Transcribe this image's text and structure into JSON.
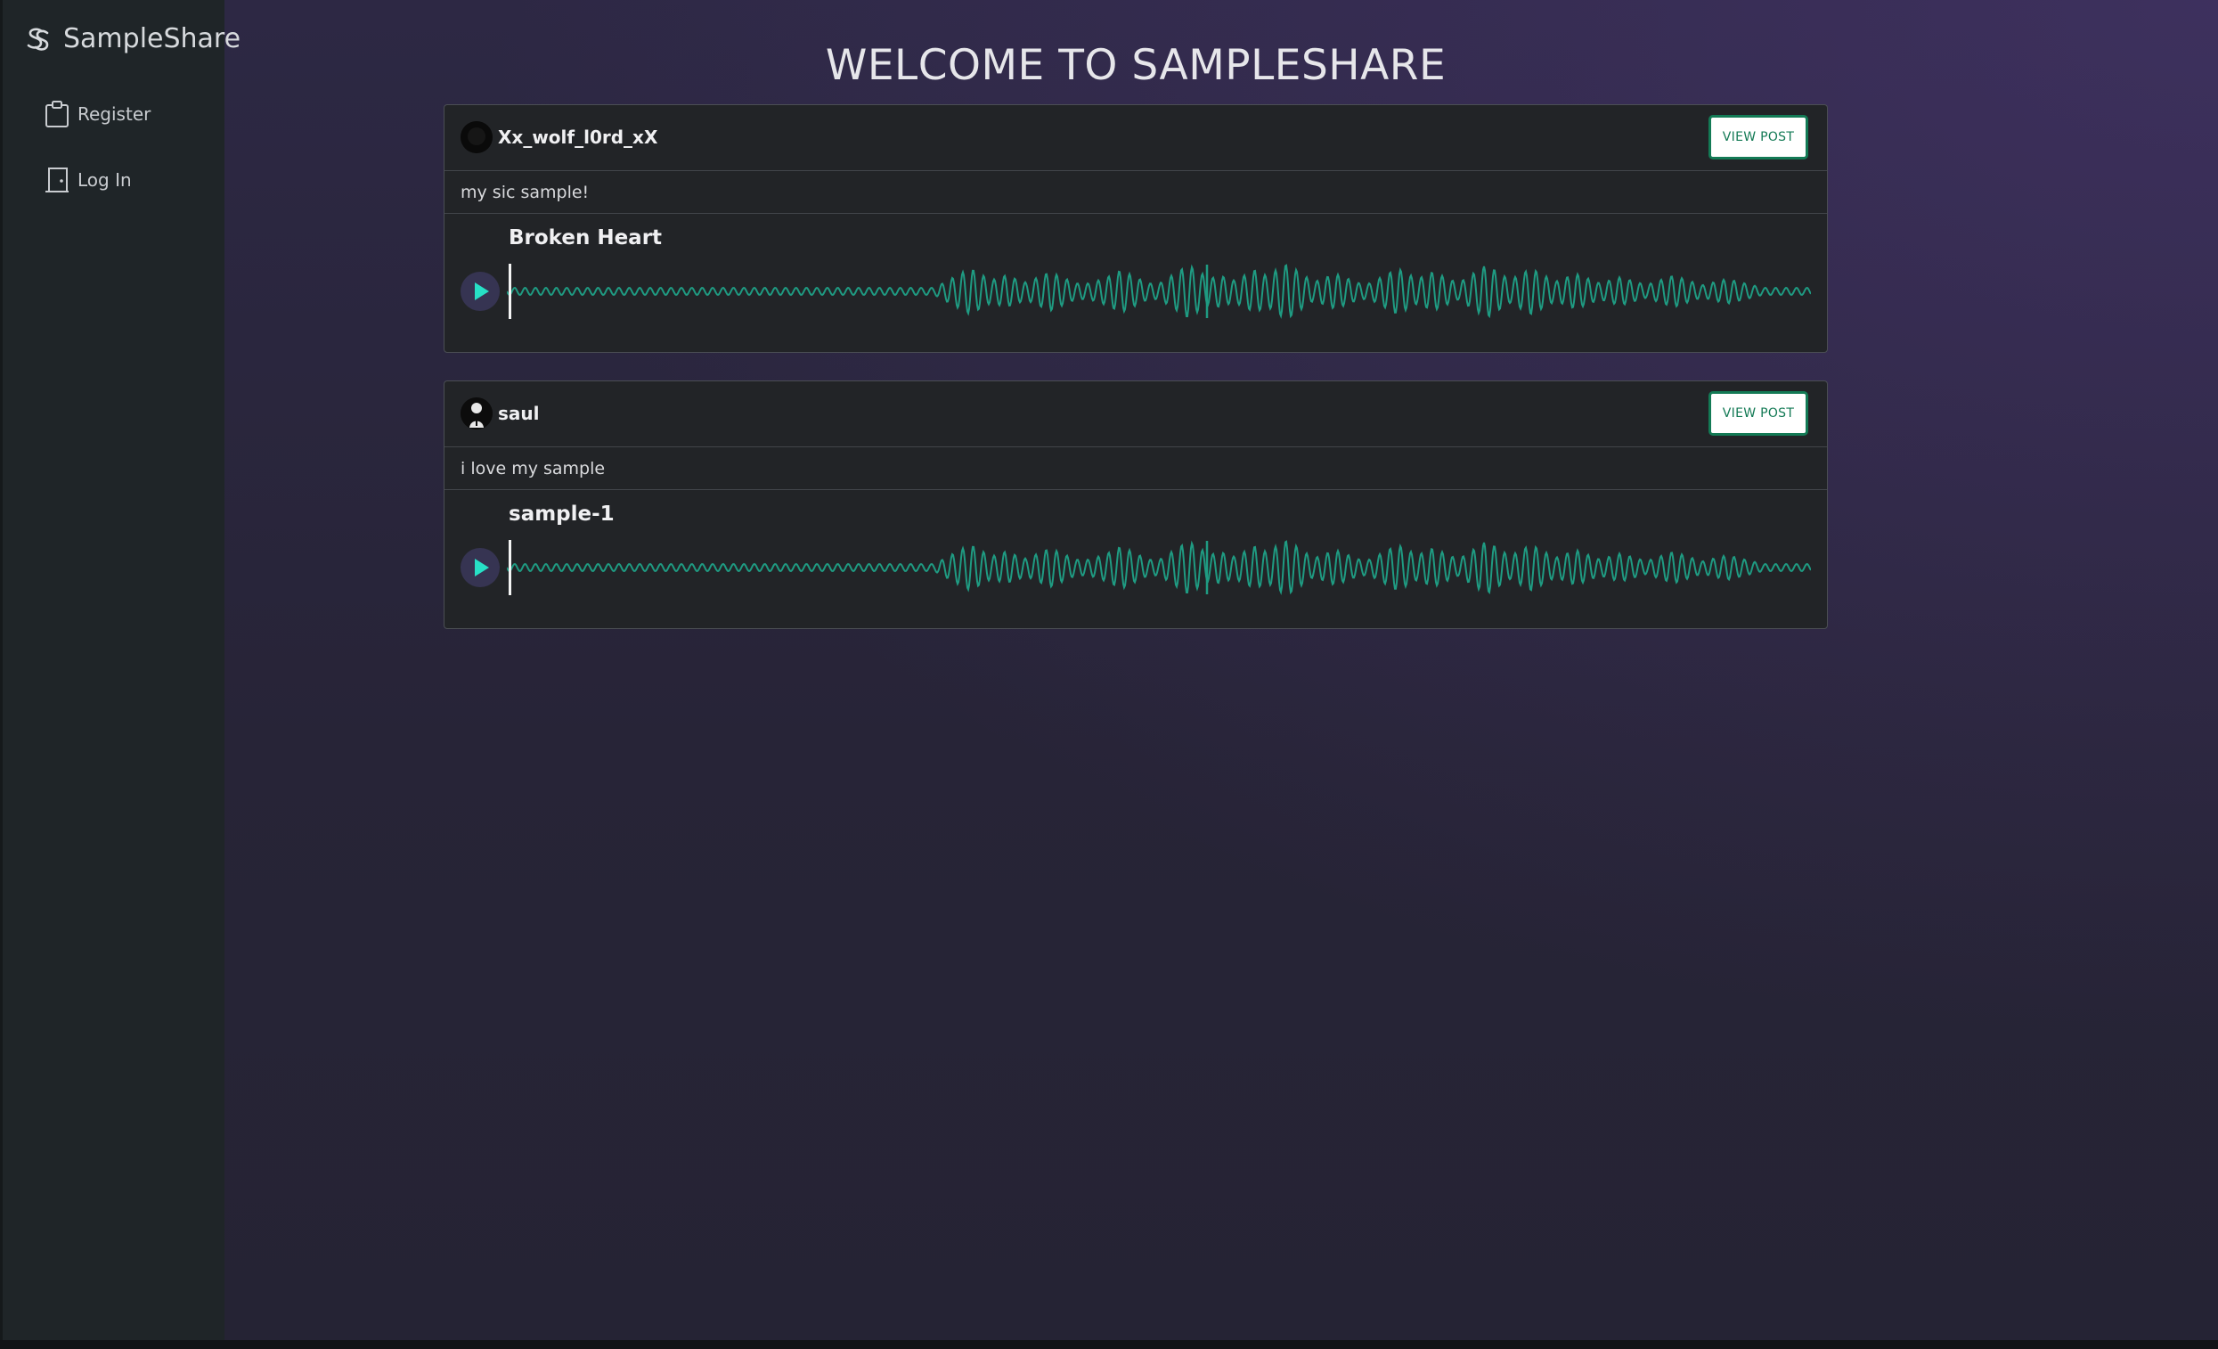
{
  "app": {
    "brand_name": "SampleShare",
    "brand_icon": "logo-icon"
  },
  "sidebar": {
    "items": [
      {
        "label": "Register",
        "icon": "clipboard-icon"
      },
      {
        "label": "Log In",
        "icon": "door-icon"
      }
    ]
  },
  "main": {
    "title": "WELCOME TO SAMPLESHARE"
  },
  "posts": [
    {
      "username": "Xx_wolf_l0rd_xX",
      "caption": "my sic sample!",
      "view_label": "VIEW POST",
      "sample_title": "Broken Heart",
      "progress": 0
    },
    {
      "username": "saul",
      "caption": "i love my sample",
      "view_label": "VIEW POST",
      "sample_title": "sample-1",
      "progress": 0
    }
  ],
  "colors": {
    "accent": "#137a55",
    "waveform": "#1f9b82",
    "play_icon": "#27e0c6"
  }
}
